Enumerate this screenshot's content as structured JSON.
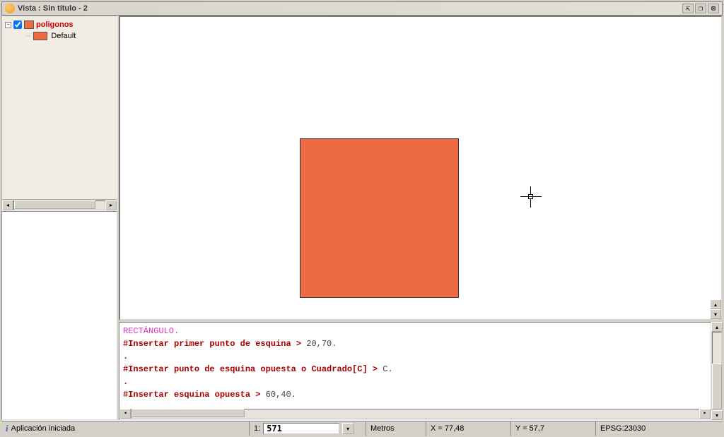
{
  "titlebar": {
    "title": "Vista : Sin título - 2"
  },
  "toc": {
    "layer_name": "poligonos",
    "default_label": "Default"
  },
  "console": {
    "command_name": "RECTÁNGULO.",
    "line1_prompt": "#Insertar primer punto de esquina >",
    "line1_value": " 20,70.",
    "line2": ".",
    "line3_prompt": "#Insertar punto de esquina opuesta o Cuadrado[C] >",
    "line3_value": " C.",
    "line4": ".",
    "line5_prompt": "#Insertar esquina opuesta >",
    "line5_value": " 60,40."
  },
  "statusbar": {
    "status_text": "Aplicación iniciada",
    "scale_prefix": "1:",
    "scale_value": "571",
    "units": "Metros",
    "x_label": "X = 77,48",
    "y_label": "Y = 57,7",
    "srs": "EPSG:23030"
  }
}
